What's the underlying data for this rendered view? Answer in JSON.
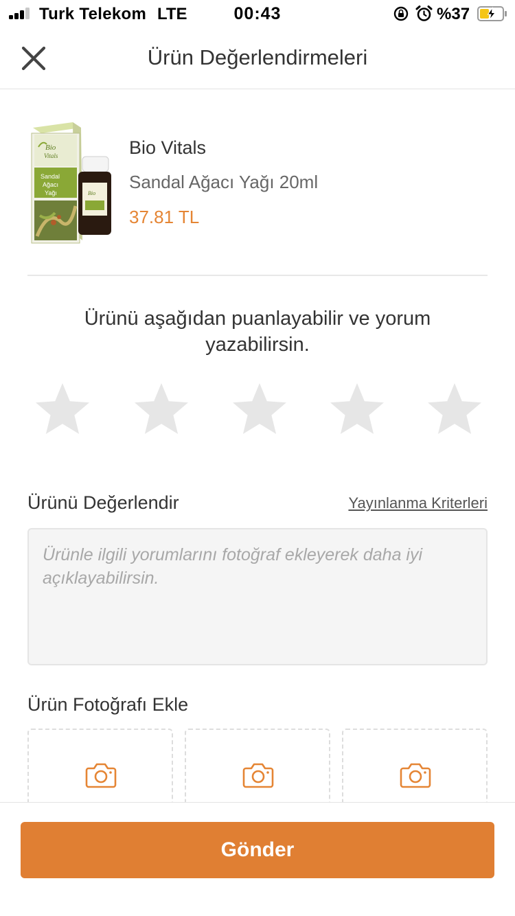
{
  "status_bar": {
    "carrier": "Turk Telekom",
    "network": "LTE",
    "time": "00:43",
    "battery": "%37"
  },
  "header": {
    "title": "Ürün Değerlendirmeleri",
    "close_icon": "close-icon"
  },
  "product": {
    "brand": "Bio Vitals",
    "name": "Sandal Ağacı Yağı 20ml",
    "price": "37.81 TL",
    "package_text": {
      "logo": "Bio Vitals",
      "line1": "Sandal",
      "line2": "Ağacı",
      "line3": "Yağı"
    }
  },
  "rating": {
    "prompt": "Ürünü aşağıdan puanlayabilir ve yorum yazabilirsin.",
    "max_stars": 5,
    "selected": 0,
    "star_icon": "star-icon"
  },
  "review": {
    "label": "Ürünü Değerlendir",
    "criteria_link": "Yayınlanma Kriterleri",
    "placeholder": "Ürünle ilgili yorumlarını fotoğraf ekleyerek daha iyi açıklayabilirsin.",
    "value": ""
  },
  "photos": {
    "label": "Ürün Fotoğrafı Ekle",
    "slots": 3,
    "icon": "camera-icon"
  },
  "footer": {
    "submit_label": "Gönder"
  },
  "colors": {
    "accent": "#e07f33",
    "price": "#e58534",
    "star_empty": "#e6e6e6",
    "text": "#333333"
  }
}
